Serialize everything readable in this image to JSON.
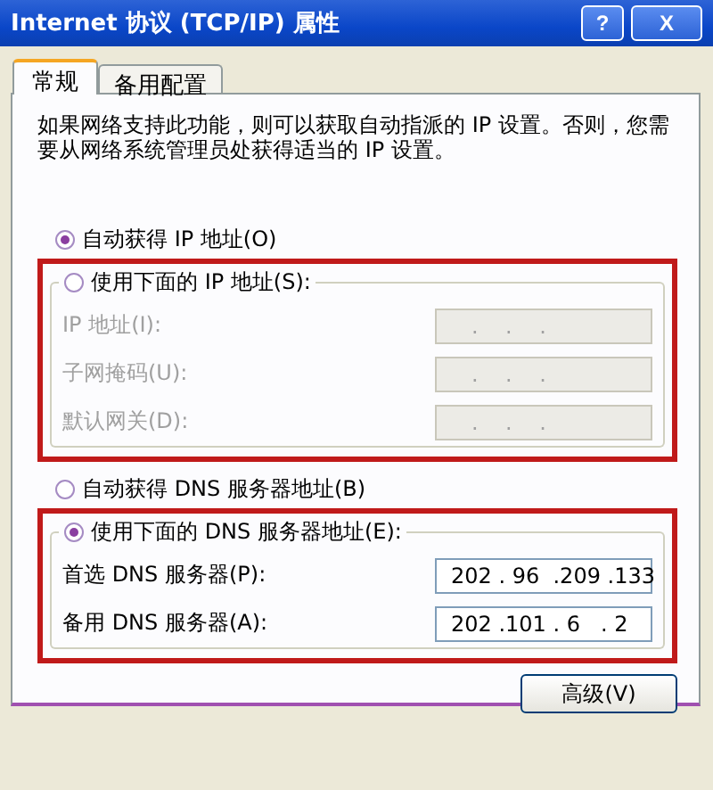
{
  "window": {
    "title": "Internet 协议 (TCP/IP) 属性",
    "help_button": "?",
    "close_button": "X"
  },
  "tabs": [
    {
      "label": "常规",
      "selected": true
    },
    {
      "label": "备用配置",
      "selected": false
    }
  ],
  "description": "如果网络支持此功能，则可以获取自动指派的 IP 设置。否则，您需要从网络系统管理员处获得适当的 IP 设置。",
  "sections": [
    {
      "auto_option": {
        "label": "自动获得 IP 地址(O)",
        "selected": true
      },
      "manual_option": {
        "label": "使用下面的 IP 地址(S):",
        "selected": false
      },
      "highlighted": true,
      "disabled": true,
      "fields": [
        {
          "label": "IP 地址(I):",
          "value": "   .    .    ."
        },
        {
          "label": "子网掩码(U):",
          "value": "   .    .    ."
        },
        {
          "label": "默认网关(D):",
          "value": "   .    .    ."
        }
      ]
    },
    {
      "auto_option": {
        "label": "自动获得 DNS 服务器地址(B)",
        "selected": false
      },
      "manual_option": {
        "label": "使用下面的 DNS 服务器地址(E):",
        "selected": true
      },
      "highlighted": true,
      "disabled": false,
      "fields": [
        {
          "label": "首选 DNS 服务器(P):",
          "value": "202 . 96  .209 .133"
        },
        {
          "label": "备用 DNS 服务器(A):",
          "value": "202 .101 . 6   . 2"
        }
      ]
    }
  ],
  "advanced_button": "高级(V)"
}
